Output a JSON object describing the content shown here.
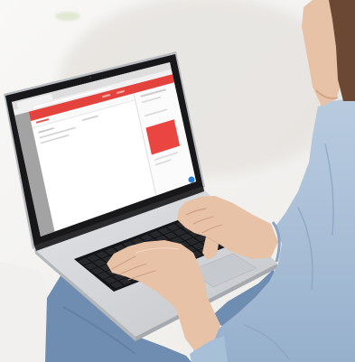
{
  "colors": {
    "background": "#f4f3f1",
    "corner_bar": "#5c5c5c",
    "screen_app_header": "#e4423d",
    "screen_app_card": "#ea4540",
    "screen_sidebar": "#a3a3a3",
    "screen_chat_button": "#2c7fd6",
    "laptop_body": "#d3d5d8",
    "laptop_bezel": "#18181a",
    "keyboard_well": "#141517",
    "shirt": "#a8bfd8",
    "jeans": "#6f8db1",
    "skin": "#e8c2a6",
    "hair": "#6b4834"
  },
  "icons": {
    "screen_chat_button": "chat-bubble-icon"
  }
}
